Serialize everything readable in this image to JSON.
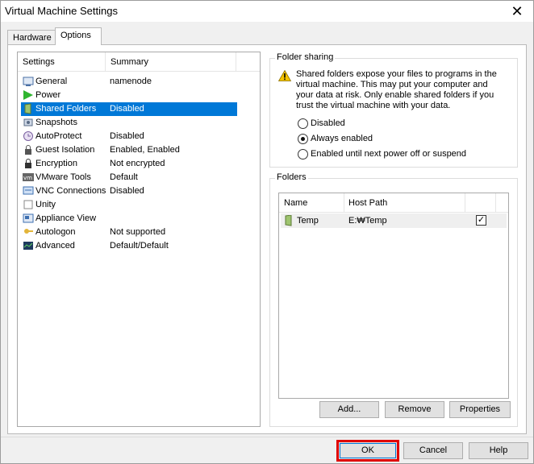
{
  "window": {
    "title": "Virtual Machine Settings",
    "close_glyph": "✕"
  },
  "tabs": [
    {
      "label": "Hardware"
    },
    {
      "label": "Options"
    }
  ],
  "settings_list": {
    "headers": {
      "settings": "Settings",
      "summary": "Summary"
    },
    "items": [
      {
        "label": "General",
        "summary": "namenode",
        "icon": "general-icon"
      },
      {
        "label": "Power",
        "summary": "",
        "icon": "power-icon"
      },
      {
        "label": "Shared Folders",
        "summary": "Disabled",
        "icon": "shared-folders-icon",
        "selected": true
      },
      {
        "label": "Snapshots",
        "summary": "",
        "icon": "snapshots-icon"
      },
      {
        "label": "AutoProtect",
        "summary": "Disabled",
        "icon": "autoprotect-icon"
      },
      {
        "label": "Guest Isolation",
        "summary": "Enabled, Enabled",
        "icon": "guest-isolation-icon"
      },
      {
        "label": "Encryption",
        "summary": "Not encrypted",
        "icon": "encryption-icon"
      },
      {
        "label": "VMware Tools",
        "summary": "Default",
        "icon": "vmware-tools-icon"
      },
      {
        "label": "VNC Connections",
        "summary": "Disabled",
        "icon": "vnc-icon"
      },
      {
        "label": "Unity",
        "summary": "",
        "icon": "unity-icon"
      },
      {
        "label": "Appliance View",
        "summary": "",
        "icon": "appliance-view-icon"
      },
      {
        "label": "Autologon",
        "summary": "Not supported",
        "icon": "autologon-icon"
      },
      {
        "label": "Advanced",
        "summary": "Default/Default",
        "icon": "advanced-icon"
      }
    ]
  },
  "folder_sharing": {
    "title": "Folder sharing",
    "warning": "Shared folders expose your files to programs in the virtual machine. This may put your computer and your data at risk. Only enable shared folders if you trust the virtual machine with your data.",
    "options": [
      {
        "label": "Disabled",
        "checked": false
      },
      {
        "label": "Always enabled",
        "checked": true
      },
      {
        "label": "Enabled until next power off or suspend",
        "checked": false
      }
    ]
  },
  "folders": {
    "title": "Folders",
    "headers": {
      "name": "Name",
      "host_path": "Host Path"
    },
    "rows": [
      {
        "name": "Temp",
        "path": "E:₩Temp",
        "enabled": true
      }
    ],
    "buttons": {
      "add": "Add...",
      "remove": "Remove",
      "properties": "Properties"
    }
  },
  "footer": {
    "ok": "OK",
    "cancel": "Cancel",
    "help": "Help"
  },
  "colors": {
    "selection": "#0078d7",
    "highlight_box": "#e00000",
    "warning": "#f5c400"
  }
}
